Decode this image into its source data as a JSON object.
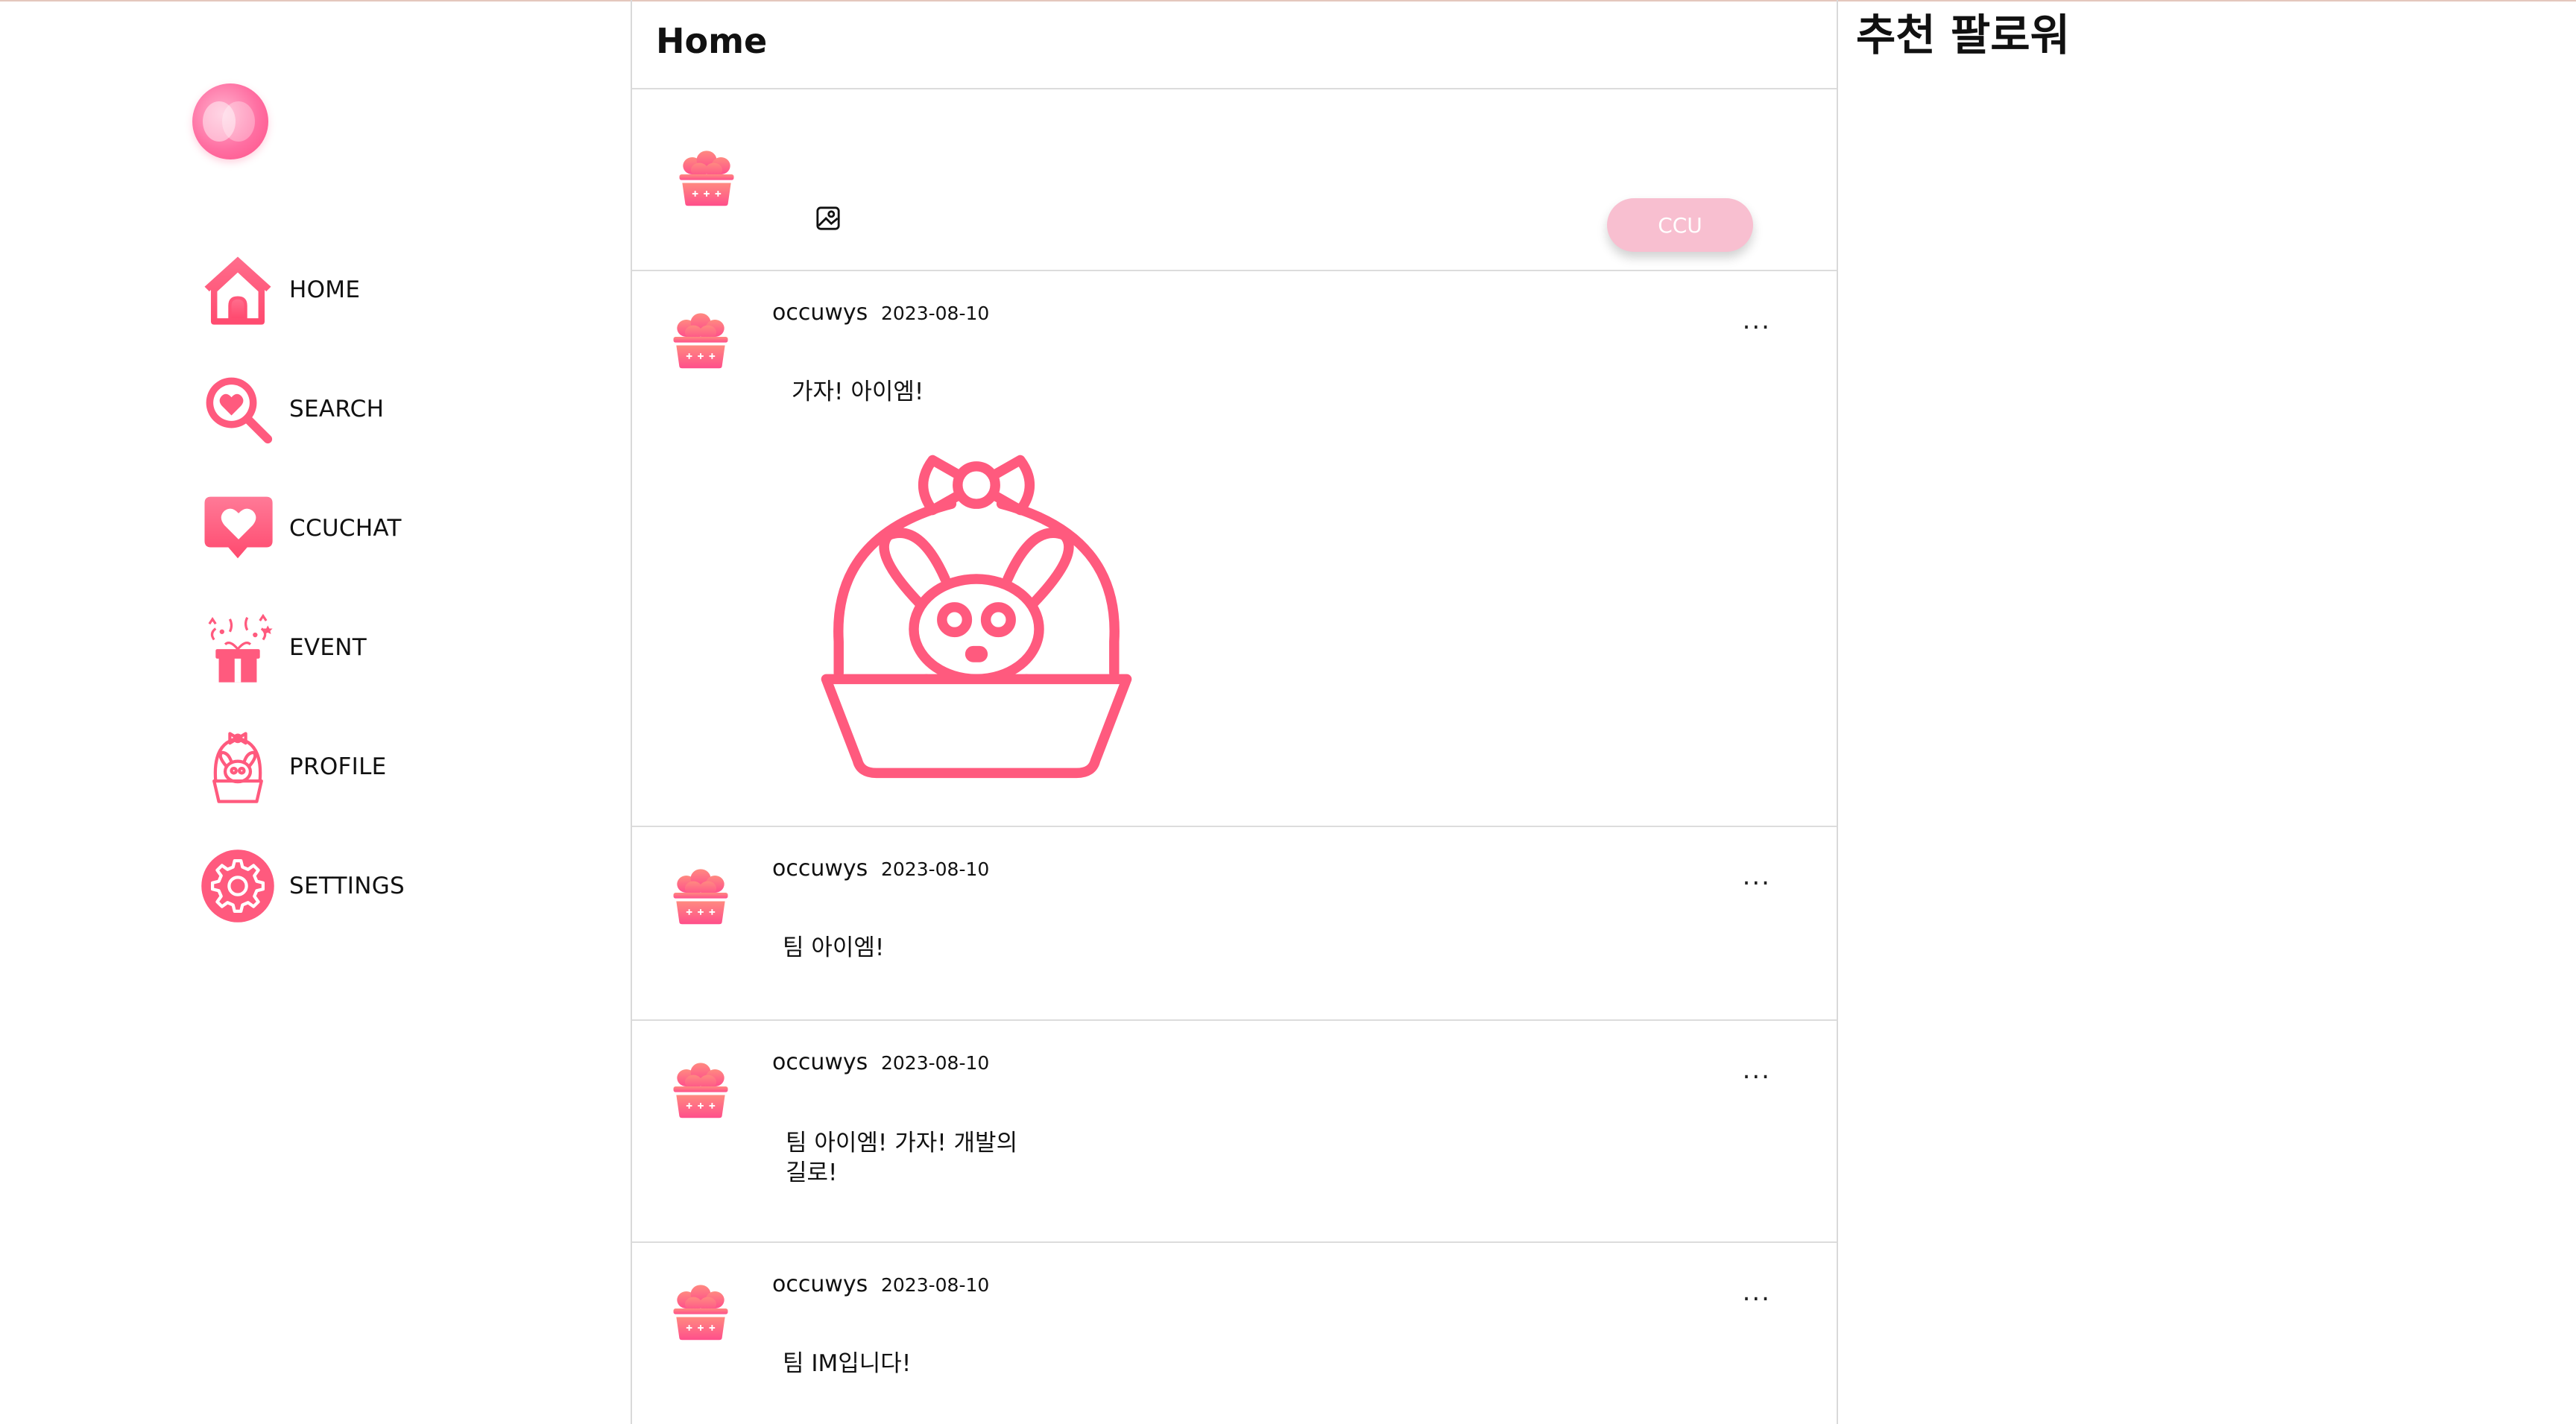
{
  "brand": {
    "accent": "#ff5a7e",
    "button_color": "#f8bfd0"
  },
  "sidebar": {
    "logo_icon": "ccu-logo-icon",
    "items": [
      {
        "label": "HOME",
        "icon": "home-icon"
      },
      {
        "label": "SEARCH",
        "icon": "search-heart-icon"
      },
      {
        "label": "CCUCHAT",
        "icon": "chat-heart-icon"
      },
      {
        "label": "EVENT",
        "icon": "gift-icon"
      },
      {
        "label": "PROFILE",
        "icon": "bunny-basket-icon"
      },
      {
        "label": "SETTINGS",
        "icon": "gear-icon"
      }
    ]
  },
  "header": {
    "title": "Home"
  },
  "composer": {
    "image_icon": "image-icon",
    "submit_label": "CCU"
  },
  "posts": [
    {
      "username": "occuwys",
      "date": "2023-08-10",
      "text": "가자! 아이엠!",
      "more": "...",
      "has_image": true,
      "image_icon": "bunny-basket-icon"
    },
    {
      "username": "occuwys",
      "date": "2023-08-10",
      "text": "팀 아이엠!",
      "more": "..."
    },
    {
      "username": "occuwys",
      "date": "2023-08-10",
      "text": "팀 아이엠! 가자! 개발의 길로!",
      "more": "..."
    },
    {
      "username": "occuwys",
      "date": "2023-08-10",
      "text": "팀 IM입니다!",
      "more": "..."
    }
  ],
  "right_panel": {
    "title": "추천 팔로워"
  }
}
